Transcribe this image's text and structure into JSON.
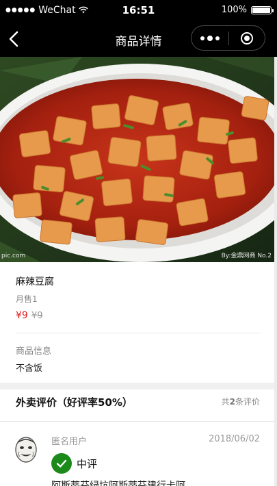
{
  "status_bar": {
    "signal": "●●●●●",
    "carrier": "WeChat",
    "time": "16:51",
    "battery": "100%"
  },
  "nav": {
    "title": "商品详情",
    "back_icon": "chevron-left-icon",
    "more_icon": "more-dots-icon",
    "close_icon": "target-circle-icon"
  },
  "product": {
    "image_watermark_left": "pic.com",
    "image_watermark_right": "By:金鼎网商 No.2",
    "name": "麻辣豆腐",
    "sold": "月售1",
    "price": "¥9",
    "original_price": "¥9",
    "info_label": "商品信息",
    "info_value": "不含饭"
  },
  "reviews": {
    "title": "外卖评价（好评率50%）",
    "count_prefix": "共",
    "count": "2",
    "count_suffix": "条评价",
    "items": [
      {
        "user": "匿名用户",
        "date": "2018/06/02",
        "rating": "中评",
        "text": "阿斯蒂芬绿坑阿斯蒂芬建行卡阿"
      }
    ]
  },
  "colors": {
    "price_red": "#e02020",
    "badge_green": "#1b8a1b",
    "nav_bg": "#000000"
  }
}
